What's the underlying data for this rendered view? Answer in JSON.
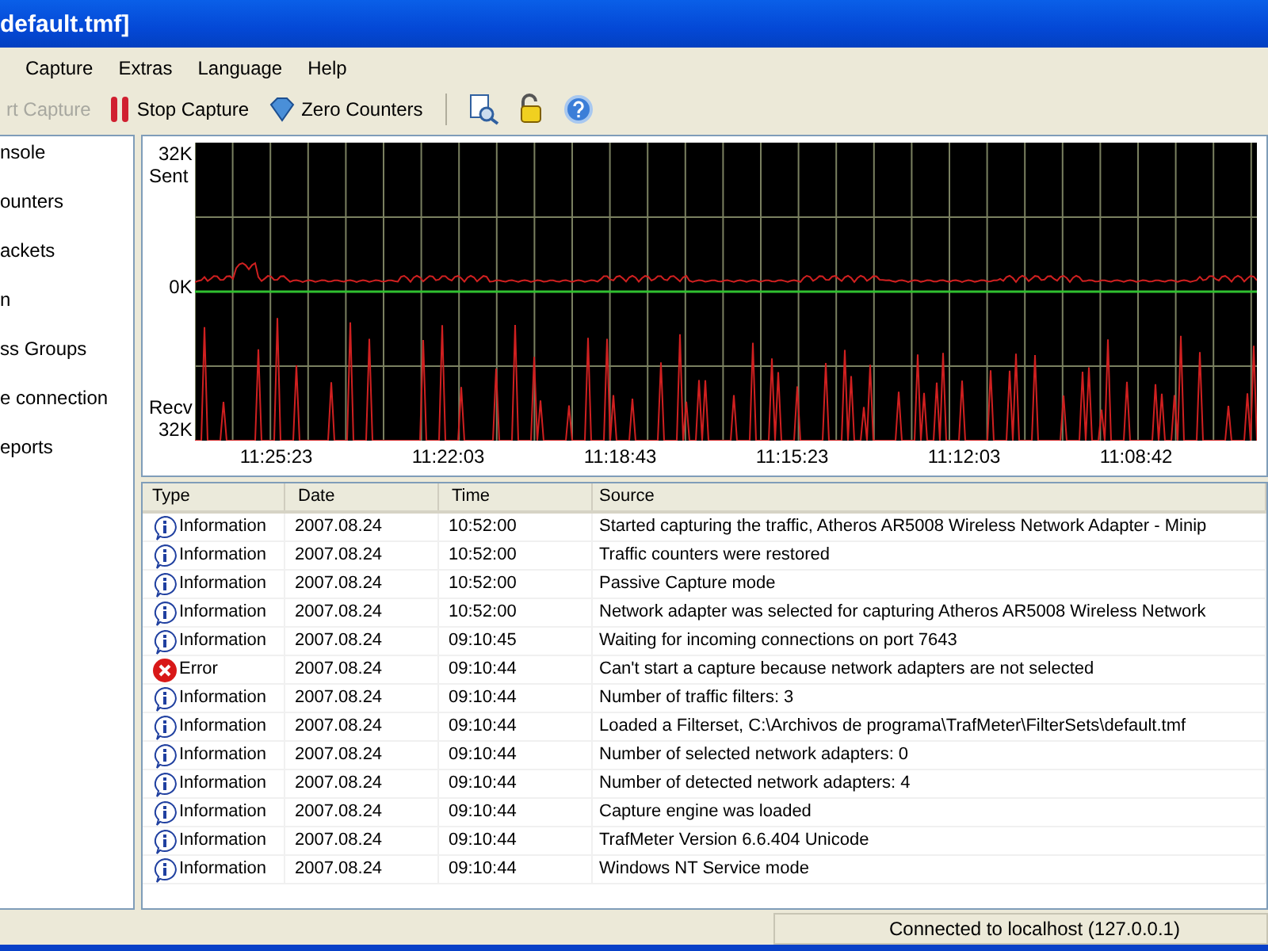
{
  "window": {
    "title": "default.tmf]"
  },
  "menu": [
    "Capture",
    "Extras",
    "Language",
    "Help"
  ],
  "toolbar": [
    {
      "kind": "start",
      "label": "rt Capture",
      "disabled": true
    },
    {
      "kind": "stop",
      "label": "Stop Capture",
      "disabled": false
    },
    {
      "kind": "zero",
      "label": "Zero Counters",
      "disabled": false
    }
  ],
  "toolbar_icons": [
    {
      "kind": "find"
    },
    {
      "kind": "lock"
    },
    {
      "kind": "help"
    }
  ],
  "sidebar": {
    "items": [
      {
        "label": "nsole"
      },
      {
        "label": "ounters"
      },
      {
        "label": "ackets"
      },
      {
        "label": "n"
      },
      {
        "label": "ss Groups"
      },
      {
        "label": "e connection"
      },
      {
        "label": "eports"
      }
    ]
  },
  "graph": {
    "y_labels": {
      "top": "32K",
      "sent": "Sent",
      "zero": "0K",
      "recv": "Recv",
      "bottom": "32K"
    },
    "x_labels": [
      "11:25:23",
      "11:22:03",
      "11:18:43",
      "11:15:23",
      "11:12:03",
      "11:08:42"
    ]
  },
  "log": {
    "columns": [
      "Type",
      "Date",
      "Time",
      "Source"
    ],
    "rows": [
      {
        "kind": "info",
        "type": "Information",
        "date": "2007.08.24",
        "time": "10:52:00",
        "source": "Started capturing the traffic, Atheros AR5008 Wireless Network Adapter - Minip"
      },
      {
        "kind": "info",
        "type": "Information",
        "date": "2007.08.24",
        "time": "10:52:00",
        "source": "Traffic counters were restored"
      },
      {
        "kind": "info",
        "type": "Information",
        "date": "2007.08.24",
        "time": "10:52:00",
        "source": "Passive Capture mode"
      },
      {
        "kind": "info",
        "type": "Information",
        "date": "2007.08.24",
        "time": "10:52:00",
        "source": "Network adapter was selected for capturing Atheros AR5008 Wireless Network"
      },
      {
        "kind": "info",
        "type": "Information",
        "date": "2007.08.24",
        "time": "09:10:45",
        "source": "Waiting for incoming connections on port 7643"
      },
      {
        "kind": "error",
        "type": "Error",
        "date": "2007.08.24",
        "time": "09:10:44",
        "source": "Can't start a capture because network adapters are not selected"
      },
      {
        "kind": "info",
        "type": "Information",
        "date": "2007.08.24",
        "time": "09:10:44",
        "source": "Number of traffic filters: 3"
      },
      {
        "kind": "info",
        "type": "Information",
        "date": "2007.08.24",
        "time": "09:10:44",
        "source": "Loaded a Filterset, C:\\Archivos de programa\\TrafMeter\\FilterSets\\default.tmf"
      },
      {
        "kind": "info",
        "type": "Information",
        "date": "2007.08.24",
        "time": "09:10:44",
        "source": "Number of selected network adapters: 0"
      },
      {
        "kind": "info",
        "type": "Information",
        "date": "2007.08.24",
        "time": "09:10:44",
        "source": "Number of detected network adapters: 4"
      },
      {
        "kind": "info",
        "type": "Information",
        "date": "2007.08.24",
        "time": "09:10:44",
        "source": "Capture engine was loaded"
      },
      {
        "kind": "info",
        "type": "Information",
        "date": "2007.08.24",
        "time": "09:10:44",
        "source": "TrafMeter Version 6.6.404 Unicode"
      },
      {
        "kind": "info",
        "type": "Information",
        "date": "2007.08.24",
        "time": "09:10:44",
        "source": "Windows NT Service mode"
      }
    ]
  },
  "status_bar": {
    "text": "Connected to localhost (127.0.0.1)"
  }
}
